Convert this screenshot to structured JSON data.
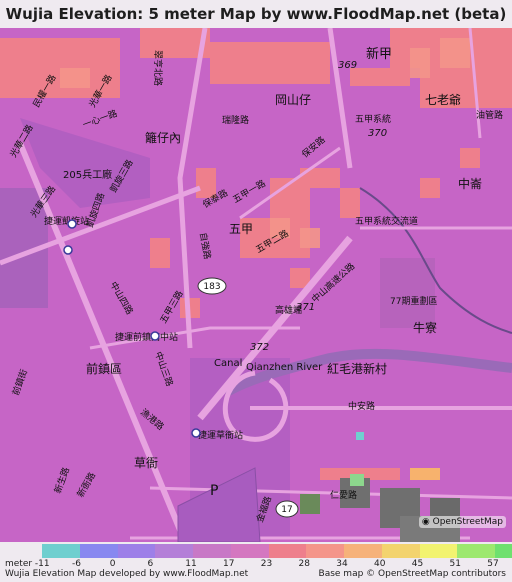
{
  "title": "Wujia Elevation: 5 meter Map by www.FloodMap.net (beta)",
  "map": {
    "place_labels": [
      "新甲",
      "岡山仔",
      "七老爺",
      "籬仔內",
      "五甲",
      "205兵工廠",
      "中崙",
      "牛寮",
      "前鎮區",
      "紅毛港新村",
      "草衙",
      "Canal",
      "Qianzhen River",
      "捷運凱旋站",
      "捷運前鎮高中站",
      "捷運草衙站",
      "77期重劃區",
      "五甲系統交流道",
      "高雄端",
      "五甲系統",
      "油管路",
      "P"
    ],
    "road_labels": [
      "一心一路",
      "光華二路",
      "光華三路",
      "凱旋四路",
      "凱旋三路",
      "保泰路",
      "保安路",
      "瑞隆路",
      "五甲一路",
      "五甲二路",
      "五甲三路",
      "中山四路",
      "中山三路",
      "中山高速公路",
      "中安路",
      "漁港路",
      "新生路",
      "前鎮街",
      "自強路",
      "翠亨北路",
      "民權一路",
      "光華一路",
      "新衙路",
      "金福路",
      "仁愛路"
    ],
    "route_shields": [
      "183",
      "17",
      "369",
      "370",
      "371",
      "372"
    ],
    "osm_badge": "OpenStreetMap",
    "colors": {
      "base": "#c665c6",
      "hot": "#f07a87",
      "low": "#8a5fbd",
      "canal": "#9a6ab8"
    }
  },
  "legend": {
    "unit_label": "meter",
    "ticks": [
      "-11",
      "-6",
      "0",
      "6",
      "11",
      "17",
      "23",
      "28",
      "34",
      "40",
      "45",
      "51",
      "57"
    ],
    "colors": [
      "#6fcfcf",
      "#8888f0",
      "#9d7fe8",
      "#b47fd8",
      "#c878c6",
      "#d477c0",
      "#ee7f8c",
      "#f4958a",
      "#f6b27a",
      "#f3d36e",
      "#f2f370",
      "#9de86f",
      "#6fe06f"
    ],
    "credit_left": "Wujia Elevation Map developed by www.FloodMap.net",
    "credit_right": "Base map © OpenStreetMap contributors"
  }
}
